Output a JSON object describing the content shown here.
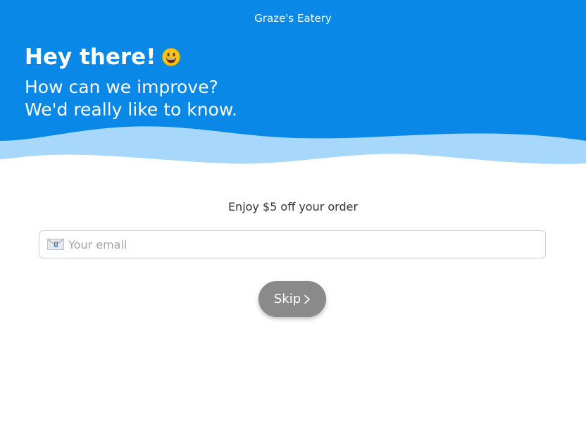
{
  "header": {
    "brand": "Graze's Eatery",
    "greeting": "Hey there!",
    "subtitle_line1": "How can we improve?",
    "subtitle_line2": "We'd really like to know.",
    "icon": "smiley-face-icon"
  },
  "form": {
    "offer_text": "Enjoy $5 off your order",
    "email": {
      "placeholder": "Your email",
      "value": "",
      "icon": "envelope-icon"
    },
    "skip_label": "Skip",
    "skip_icon": "chevron-right-icon"
  },
  "colors": {
    "primary_blue": "#0a88e8",
    "wave_light_blue": "#a7d7fb",
    "button_gray": "#8a8a8a",
    "background": "#ffffff"
  }
}
